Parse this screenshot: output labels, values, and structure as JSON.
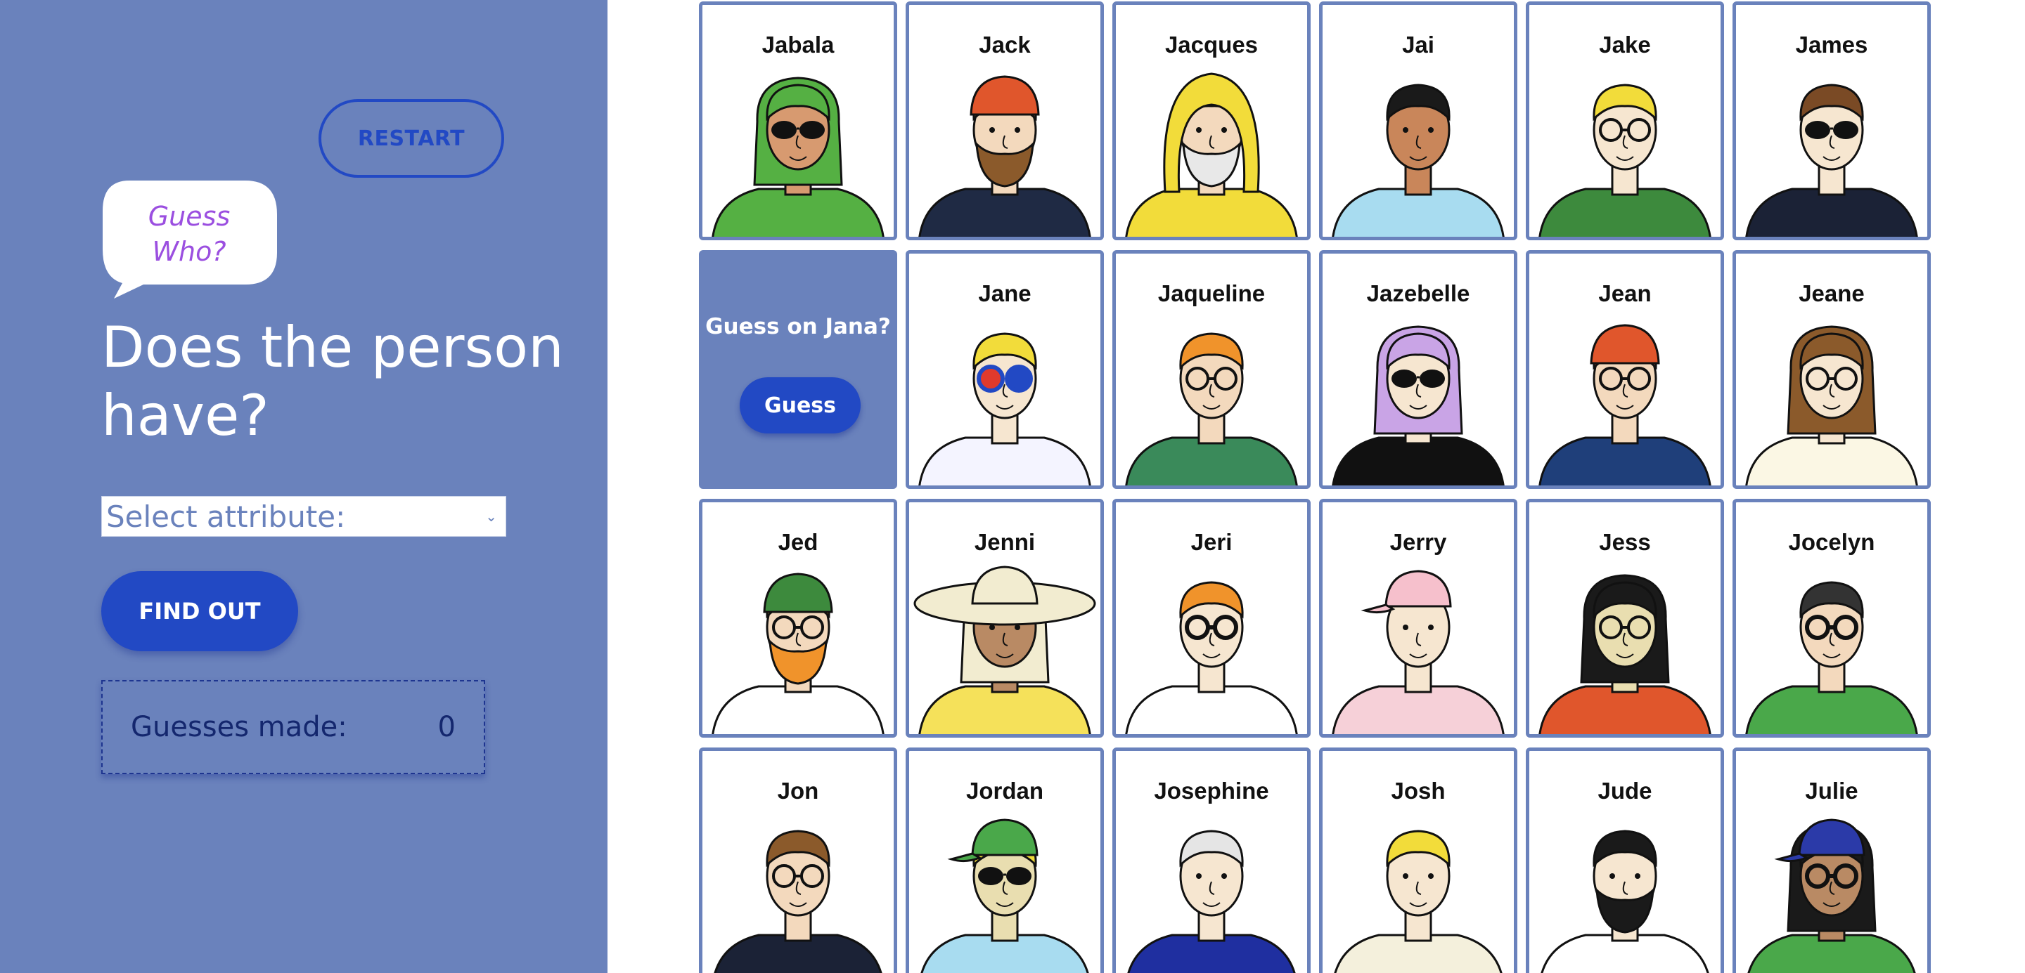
{
  "sidebar": {
    "restart_label": "RESTART",
    "bubble_text": "Guess Who?",
    "heading": "Does the person have?",
    "select_placeholder": "Select attribute:",
    "find_out_label": "FIND OUT",
    "guesses_label": "Guesses made:",
    "guesses_count": "0"
  },
  "guess_card": {
    "prompt": "Guess on Jana?",
    "button_label": "Guess"
  },
  "characters": [
    {
      "name": "Jabala",
      "skin": "#d79a70",
      "hair": "#55b043",
      "shirt": "#55b043",
      "hat": "none",
      "glasses": "sun",
      "extra": "none"
    },
    {
      "name": "Jack",
      "skin": "#f3d9bd",
      "hair": "#8b5a2b",
      "shirt": "#1f2a44",
      "hat": "bandana",
      "glasses": "none",
      "extra": "beard"
    },
    {
      "name": "Jacques",
      "skin": "#f3d9bd",
      "hair": "#f2dc3a",
      "shirt": "#f2dc3a",
      "hat": "hood",
      "glasses": "none",
      "extra": "beard"
    },
    {
      "name": "Jai",
      "skin": "#c9865a",
      "hair": "#1a1a1a",
      "shirt": "#a8dcf0",
      "hat": "none",
      "glasses": "none",
      "extra": "none"
    },
    {
      "name": "Jake",
      "skin": "#f6e6d0",
      "hair": "#f2dc3a",
      "shirt": "#3d8a3d",
      "hat": "none",
      "glasses": "clear",
      "extra": "none"
    },
    {
      "name": "James",
      "skin": "#f6e6d0",
      "hair": "#7a4a25",
      "shirt": "#1b2236",
      "hat": "none",
      "glasses": "sun",
      "extra": "none"
    },
    {
      "name": "Jane",
      "skin": "#f6e6d0",
      "hair": "#f2dc3a",
      "shirt": "#f4f4ff",
      "hat": "none",
      "glasses": "color",
      "extra": "none"
    },
    {
      "name": "Jaqueline",
      "skin": "#f3d9bd",
      "hair": "#f0932b",
      "shirt": "#3a8a5a",
      "hat": "none",
      "glasses": "clear",
      "extra": "none"
    },
    {
      "name": "Jazebelle",
      "skin": "#f6e6d0",
      "hair": "#c9a4e6",
      "shirt": "#111111",
      "hat": "none",
      "glasses": "sun",
      "extra": "none"
    },
    {
      "name": "Jean",
      "skin": "#f3d9bd",
      "hair": "#e0562c",
      "shirt": "#1f3f7a",
      "hat": "beanie",
      "glasses": "clear",
      "extra": "none"
    },
    {
      "name": "Jeane",
      "skin": "#f6e6d0",
      "hair": "#8b5a2b",
      "shirt": "#fbf7e4",
      "hat": "none",
      "glasses": "clear",
      "extra": "none"
    },
    {
      "name": "Jed",
      "skin": "#f3d9bd",
      "hair": "#f0932b",
      "shirt": "#ffffff",
      "hat": "beanie-green",
      "glasses": "clear",
      "extra": "beard-orange"
    },
    {
      "name": "Jenni",
      "skin": "#b98a64",
      "hair": "#f2ecd0",
      "shirt": "#f5e15a",
      "hat": "sunhat",
      "glasses": "none",
      "extra": "none"
    },
    {
      "name": "Jeri",
      "skin": "#f6e6d0",
      "hair": "#f0932b",
      "shirt": "#ffffff",
      "hat": "none",
      "glasses": "clear-thick",
      "extra": "none"
    },
    {
      "name": "Jerry",
      "skin": "#f6e6d0",
      "hair": "#f6e6d0",
      "shirt": "#f6d0d8",
      "hat": "cap-pink",
      "glasses": "none",
      "extra": "none"
    },
    {
      "name": "Jess",
      "skin": "#e9deb0",
      "hair": "#1a1a1a",
      "shirt": "#e0562c",
      "hat": "none",
      "glasses": "clear",
      "extra": "none"
    },
    {
      "name": "Jocelyn",
      "skin": "#f3d9bd",
      "hair": "#333333",
      "shirt": "#4aa84a",
      "hat": "none",
      "glasses": "clear-thick",
      "extra": "none"
    },
    {
      "name": "Jon",
      "skin": "#f3d9bd",
      "hair": "#8b5a2b",
      "shirt": "#1b2236",
      "hat": "none",
      "glasses": "clear",
      "extra": "none"
    },
    {
      "name": "Jordan",
      "skin": "#e9deb0",
      "hair": "#f2dc3a",
      "shirt": "#a8dcf0",
      "hat": "cap-green",
      "glasses": "sun",
      "extra": "none"
    },
    {
      "name": "Josephine",
      "skin": "#f6e6d0",
      "hair": "#e5e5e5",
      "shirt": "#1f2fa0",
      "hat": "none",
      "glasses": "none",
      "extra": "none"
    },
    {
      "name": "Josh",
      "skin": "#f6e6d0",
      "hair": "#f2dc3a",
      "shirt": "#f4f0dc",
      "hat": "none",
      "glasses": "none",
      "extra": "none"
    },
    {
      "name": "Jude",
      "skin": "#f6e6d0",
      "hair": "#1a1a1a",
      "shirt": "#ffffff",
      "hat": "none",
      "glasses": "none",
      "extra": "beard-black"
    },
    {
      "name": "Julie",
      "skin": "#b98a64",
      "hair": "#1a1a1a",
      "shirt": "#4aa84a",
      "hat": "cap-blue",
      "glasses": "clear-thick",
      "extra": "none"
    }
  ]
}
